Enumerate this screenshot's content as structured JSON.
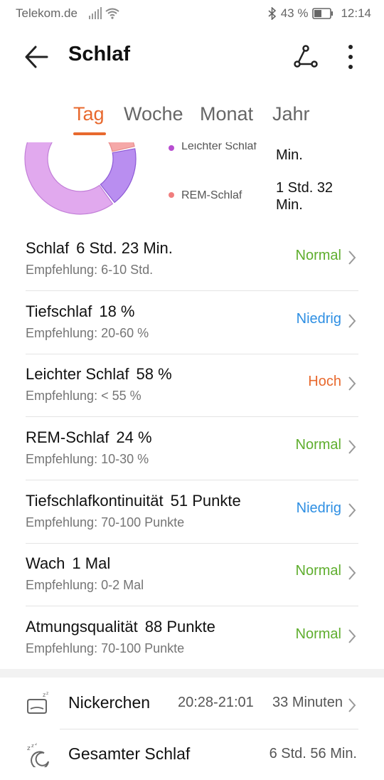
{
  "status_bar": {
    "carrier": "Telekom.de",
    "battery": "43 %",
    "time": "12:14",
    "icons": [
      "signal-icon",
      "wifi-icon",
      "bluetooth-icon",
      "battery-icon"
    ]
  },
  "app_bar": {
    "title": "Schlaf",
    "icons": [
      "back-arrow-icon",
      "route-icon",
      "more-vert-icon"
    ]
  },
  "tabs": [
    {
      "label": "Tag",
      "active": true
    },
    {
      "label": "Woche",
      "active": false
    },
    {
      "label": "Monat",
      "active": false
    },
    {
      "label": "Jahr",
      "active": false
    }
  ],
  "chart_data": {
    "type": "pie",
    "variant": "donut",
    "series": [
      {
        "name": "Tiefschlaf",
        "value": 18,
        "color": "#b98ef0"
      },
      {
        "name": "Leichter Schlaf",
        "value": 58,
        "color": "#e1a9ee"
      },
      {
        "name": "REM-Schlaf",
        "value": 24,
        "color": "#f5a8a8"
      }
    ]
  },
  "legend": [
    {
      "label": "Leichter Schlaf",
      "value": "Min.",
      "color": "#b74dd0"
    },
    {
      "label": "REM-Schlaf",
      "value_line1": "1 Std. 32",
      "value_line2": "Min.",
      "color": "#f07e7e"
    }
  ],
  "metrics": [
    {
      "name": "Schlaf",
      "value": "6 Std. 23 Min.",
      "recommendation": "Empfehlung: 6-10 Std.",
      "status": "Normal",
      "status_color": "#5fae2e"
    },
    {
      "name": "Tiefschlaf",
      "value": "18 %",
      "recommendation": "Empfehlung: 20-60 %",
      "status": "Niedrig",
      "status_color": "#2e8fe3"
    },
    {
      "name": "Leichter Schlaf",
      "value": "58 %",
      "recommendation": "Empfehlung: < 55 %",
      "status": "Hoch",
      "status_color": "#e8692e"
    },
    {
      "name": "REM-Schlaf",
      "value": "24 %",
      "recommendation": "Empfehlung: 10-30 %",
      "status": "Normal",
      "status_color": "#5fae2e"
    },
    {
      "name": "Tiefschlafkontinuität",
      "value": "51 Punkte",
      "recommendation": "Empfehlung: 70-100 Punkte",
      "status": "Niedrig",
      "status_color": "#2e8fe3"
    },
    {
      "name": "Wach",
      "value": "1 Mal",
      "recommendation": "Empfehlung: 0-2 Mal",
      "status": "Normal",
      "status_color": "#5fae2e"
    },
    {
      "name": "Atmungsqualität",
      "value": "88 Punkte",
      "recommendation": "Empfehlung: 70-100 Punkte",
      "status": "Normal",
      "status_color": "#5fae2e"
    }
  ],
  "nap": {
    "label": "Nickerchen",
    "time": "20:28-21:01",
    "duration": "33 Minuten",
    "icon": "nap-pillow-icon"
  },
  "total": {
    "label": "Gesamter Schlaf",
    "duration": "6 Std. 56 Min.",
    "icon": "moon-zzz-icon"
  }
}
